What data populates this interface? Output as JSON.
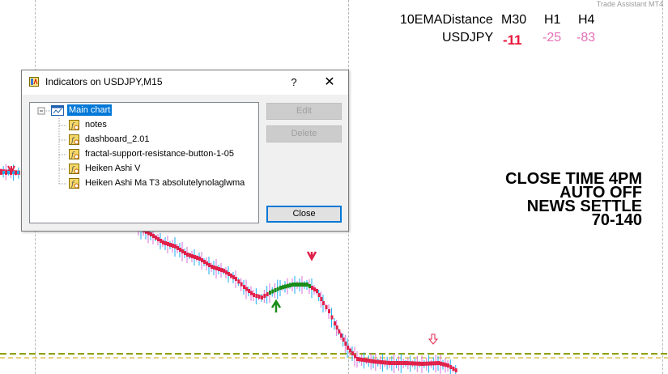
{
  "watermark": "Trade Assistant MT4",
  "dashboard": {
    "name": "10EMADistance",
    "symbol": "USDJPY",
    "timeframes": [
      "M30",
      "H1",
      "H4"
    ],
    "values": [
      "-11",
      "-25",
      "-83"
    ],
    "colors": {
      "strong": "#e8183c",
      "weak": "#e46fb6",
      "text": "#000000"
    }
  },
  "notes": [
    "CLOSE TIME 4PM",
    "AUTO OFF",
    "NEWS SETTLE",
    "70-140"
  ],
  "dialog": {
    "title": "Indicators on USDJPY,M15",
    "help_label": "?",
    "close_symbol": "✕",
    "tree": {
      "root": "Main chart",
      "items": [
        "notes",
        "dashboard_2.01",
        "fractal-support-resistance-button-1-05",
        "Heiken Ashi V",
        "Heiken Ashi Ma T3 absolutelynolaglwma"
      ]
    },
    "buttons": {
      "edit": "Edit",
      "delete": "Delete",
      "close": "Close"
    }
  },
  "chart_colors": {
    "bear": "#e0214a",
    "bull": "#1a8c1a",
    "bull_wick": "#1aaef0",
    "bear_wick": "#d870d8",
    "level": "#8aa000",
    "grid": "#b9b9b9"
  }
}
